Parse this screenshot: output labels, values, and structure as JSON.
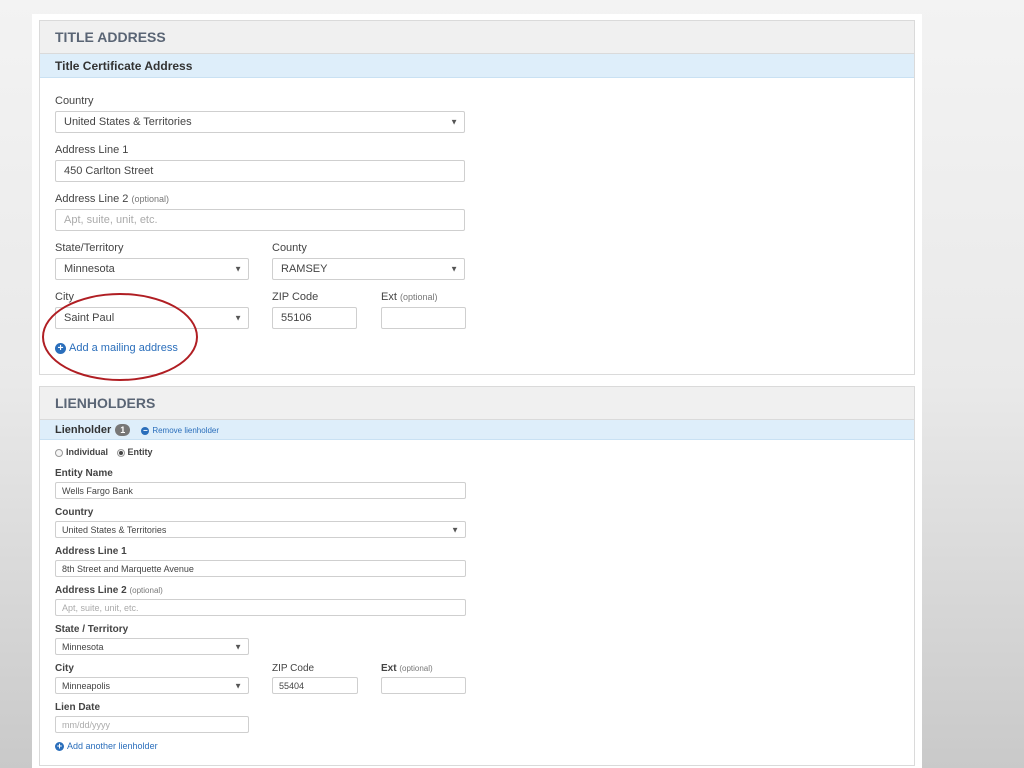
{
  "title_address": {
    "heading": "TITLE ADDRESS",
    "subheading": "Title Certificate Address",
    "country_label": "Country",
    "country_value": "United States & Territories",
    "address1_label": "Address Line 1",
    "address1_value": "450 Carlton Street",
    "address2_label": "Address Line 2",
    "address2_optional": "(optional)",
    "address2_placeholder": "Apt, suite, unit, etc.",
    "state_label": "State/Territory",
    "state_value": "Minnesota",
    "county_label": "County",
    "county_value": "RAMSEY",
    "city_label": "City",
    "city_value": "Saint Paul",
    "zip_label": "ZIP Code",
    "zip_value": "55106",
    "ext_label": "Ext",
    "ext_optional": "(optional)",
    "ext_value": "",
    "add_mailing_link": "Add a mailing address"
  },
  "lienholders": {
    "heading": "LIENHOLDERS",
    "lienholder_label": "Lienholder",
    "lienholder_count": "1",
    "remove_link": "Remove lienholder",
    "radio_individual": "Individual",
    "radio_entity": "Entity",
    "entity_name_label": "Entity Name",
    "entity_name_value": "Wells Fargo Bank",
    "country_label": "Country",
    "country_value": "United States & Territories",
    "address1_label": "Address Line 1",
    "address1_value": "8th Street and Marquette Avenue",
    "address2_label": "Address Line 2",
    "address2_optional": "(optional)",
    "address2_placeholder": "Apt, suite, unit, etc.",
    "state_label": "State / Territory",
    "state_value": "Minnesota",
    "city_label": "City",
    "city_value": "Minneapolis",
    "zip_label": "ZIP Code",
    "zip_value": "55404",
    "ext_label": "Ext",
    "ext_optional": "(optional)",
    "ext_value": "",
    "lien_date_label": "Lien Date",
    "lien_date_placeholder": "mm/dd/yyyy",
    "add_another_link": "Add another lienholder"
  },
  "colors": {
    "accent": "#2a6ebb",
    "highlight_circle": "#b01e23",
    "subheader_bg": "#deeefa"
  },
  "icons": {
    "dropdown": "caret-down-icon",
    "add": "plus-circle-icon",
    "remove": "minus-circle-icon"
  }
}
